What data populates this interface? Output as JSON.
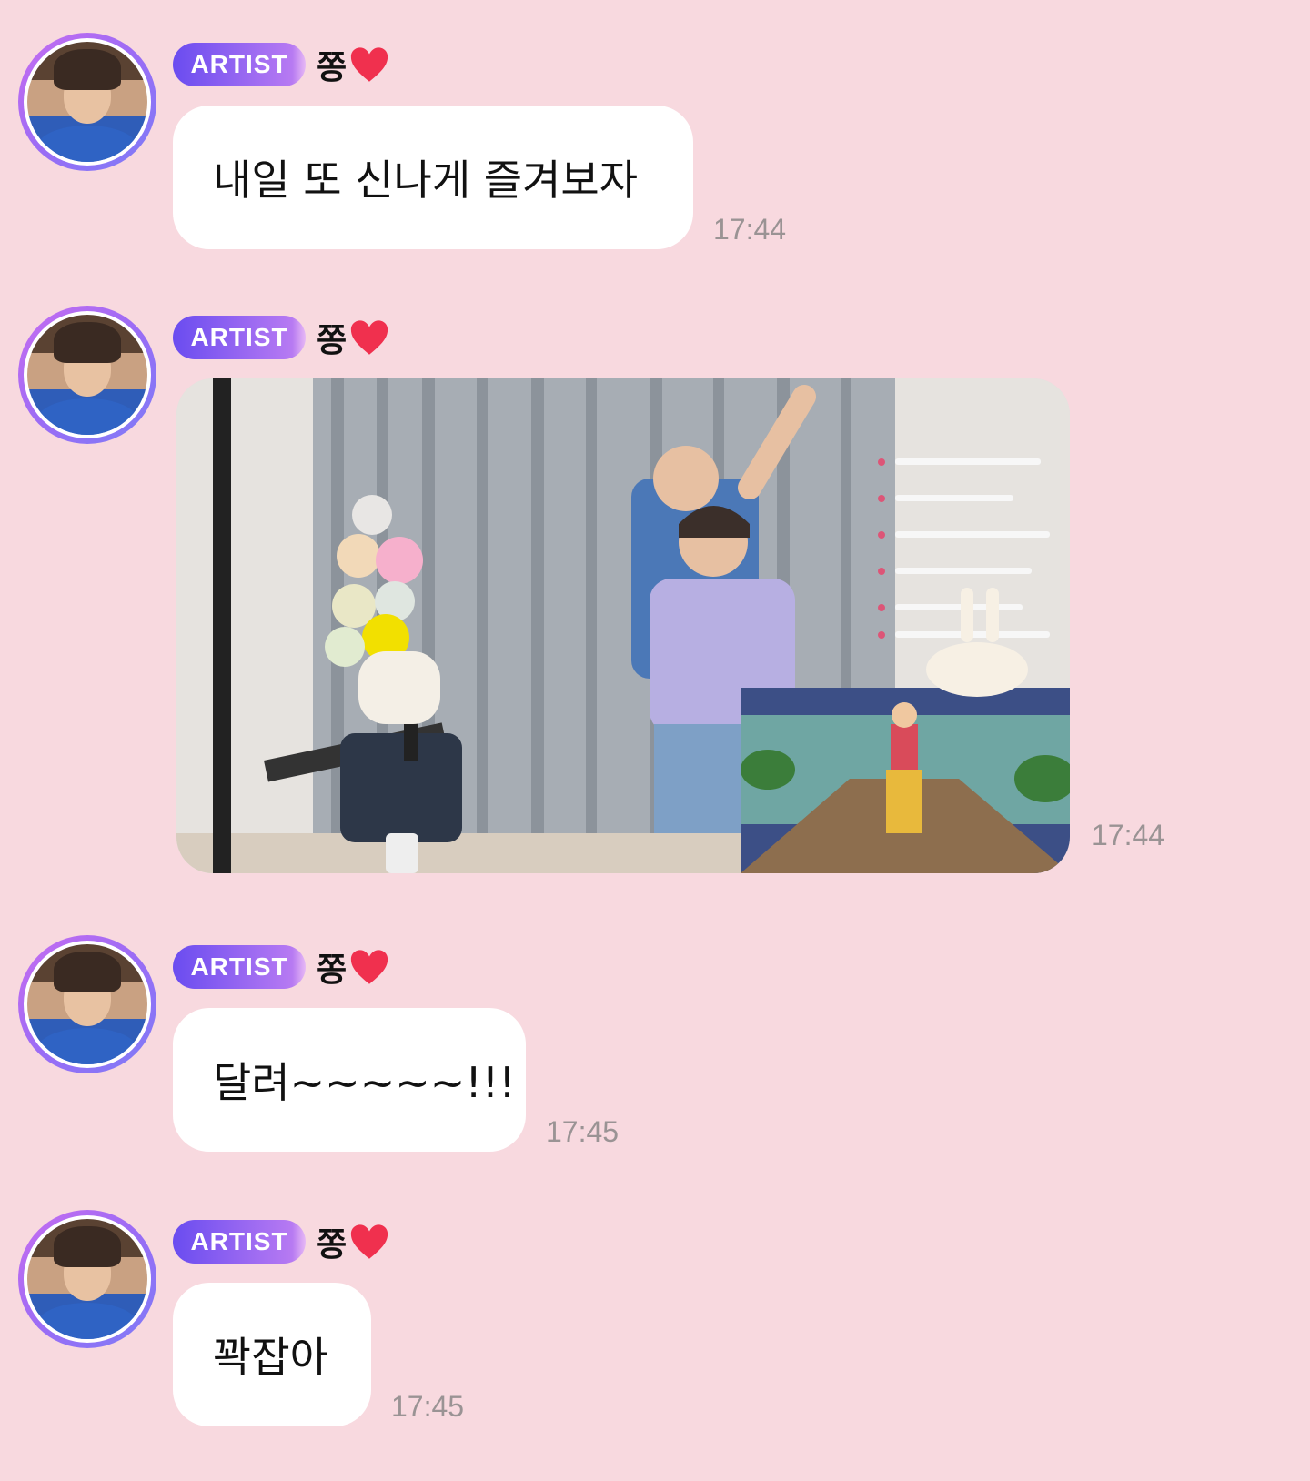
{
  "messages": [
    {
      "badge": "ARTIST",
      "name": "쫑",
      "text": "내일 또 신나게 즐겨보자",
      "time": "17:44"
    },
    {
      "badge": "ARTIST",
      "name": "쫑",
      "media": "photo",
      "time": "17:44"
    },
    {
      "badge": "ARTIST",
      "name": "쫑",
      "text": "달려~~~~~!!!",
      "time": "17:45"
    },
    {
      "badge": "ARTIST",
      "name": "쫑",
      "text": "꽉잡아",
      "time": "17:45"
    }
  ],
  "colors": {
    "background": "#f8d9df",
    "badge_start": "#6a4cf0",
    "badge_end": "#e7b9f5",
    "heart": "#f0304e",
    "time": "#9a9394"
  }
}
